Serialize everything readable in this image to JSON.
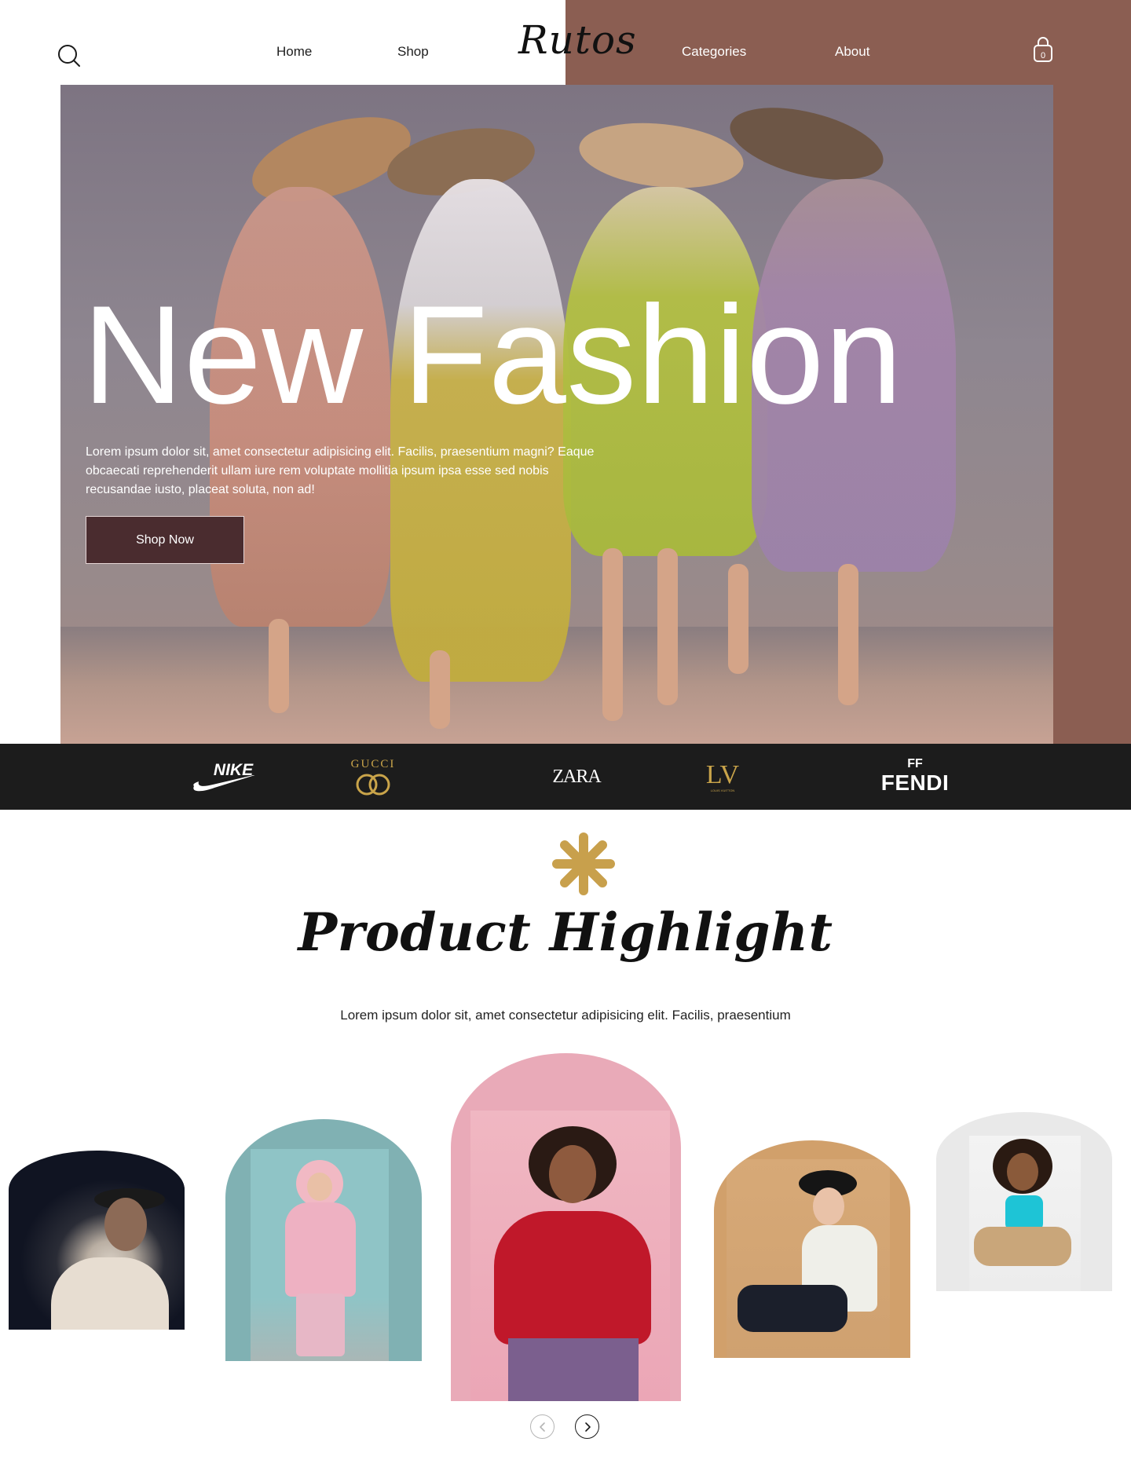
{
  "header": {
    "logo": "Rutos",
    "nav": {
      "home": "Home",
      "shop": "Shop",
      "categories": "Categories",
      "about": "About"
    },
    "cart_count": "0",
    "icons": {
      "search": "search-icon",
      "cart": "shopping-bag-icon"
    }
  },
  "hero": {
    "title": "New Fashion",
    "description": "Lorem ipsum dolor sit, amet consectetur adipisicing elit. Facilis, praesentium magni? Eaque obcaecati reprehenderit ullam iure rem voluptate mollitia ipsum ipsa esse sed nobis recusandae iusto, placeat soluta, non ad!",
    "cta_label": "Shop Now"
  },
  "brands": {
    "nike": "NIKE",
    "gucci": "GUCCI",
    "zara": "ZARA",
    "lv": "LV",
    "lv_small": "LOUIS VUITTON",
    "fendi": "FENDI",
    "fendi_mark": "FF"
  },
  "highlight": {
    "title": "Product Highlight",
    "subtitle": "Lorem ipsum dolor sit, amet consectetur adipisicing elit. Facilis, praesentium",
    "icon": "asterisk-icon"
  },
  "carousel": {
    "prev_icon": "chevron-left-icon",
    "next_icon": "chevron-right-icon"
  },
  "colors": {
    "accent_brown": "#8b5e52",
    "brand_strip": "#1c1c1c",
    "cta": "#4a2c2f",
    "gold": "#c9a44a",
    "card_navy": "#101422",
    "card_teal": "#80b1b3",
    "card_pink": "#e9aab8",
    "card_tan": "#d1a06b",
    "card_grey": "#e9e9e9"
  }
}
